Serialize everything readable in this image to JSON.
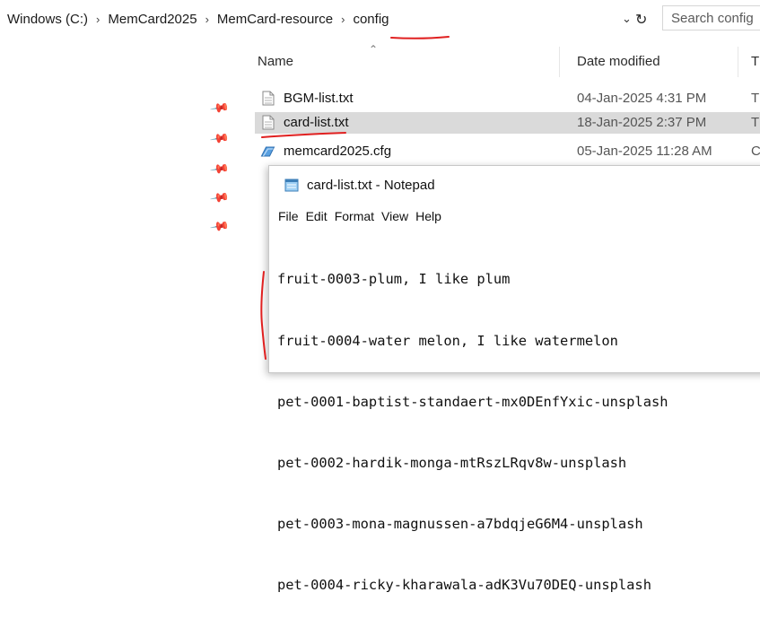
{
  "breadcrumb": {
    "items": [
      "Windows (C:)",
      "MemCard2025",
      "MemCard-resource",
      "config"
    ],
    "separator": "›"
  },
  "toolbar": {
    "dropdown_icon": "chevron-down-icon",
    "refresh_icon": "refresh-icon",
    "search_placeholder": "Search config"
  },
  "columns": {
    "name": "Name",
    "date_modified": "Date modified",
    "type": "T"
  },
  "files": [
    {
      "name": "BGM-list.txt",
      "date": "04-Jan-2025 4:31 PM",
      "type": "T",
      "icon": "text-file-icon",
      "selected": false
    },
    {
      "name": "card-list.txt",
      "date": "18-Jan-2025 2:37 PM",
      "type": "T",
      "icon": "text-file-icon",
      "selected": true
    },
    {
      "name": "memcard2025.cfg",
      "date": "05-Jan-2025 11:28 AM",
      "type": "C",
      "icon": "config-file-icon",
      "selected": false
    }
  ],
  "notepad": {
    "title": "card-list.txt - Notepad",
    "menu": [
      "File",
      "Edit",
      "Format",
      "View",
      "Help"
    ],
    "lines": [
      "fruit-0003-plum, I like plum",
      "fruit-0004-water melon, I like watermelon",
      "pet-0001-baptist-standaert-mx0DEnfYxic-unsplash",
      "pet-0002-hardik-monga-mtRszLRqv8w-unsplash",
      "pet-0003-mona-magnussen-a7bdqjeG6M4-unsplash",
      "pet-0004-ricky-kharawala-adK3Vu70DEQ-unsplash"
    ]
  },
  "colors": {
    "annotation": "#e02020",
    "selection": "#dadada",
    "folder_icon": "#4a90d9"
  }
}
